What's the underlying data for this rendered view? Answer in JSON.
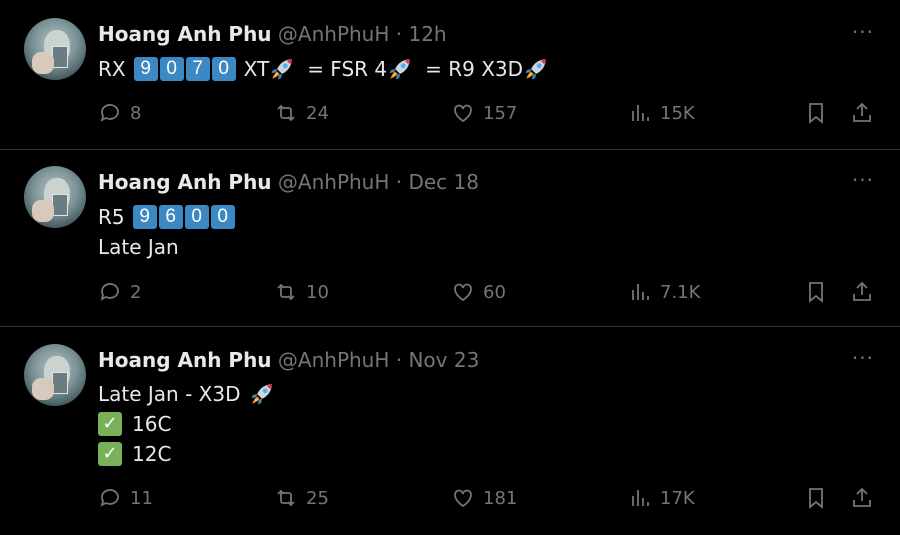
{
  "tweets": [
    {
      "name": "Hoang Anh Phu",
      "handle": "@AnhPhuH",
      "dot": "·",
      "time": "12h",
      "more": "···",
      "line1": {
        "pre": "RX",
        "digits": [
          "9",
          "0",
          "7",
          "0"
        ],
        "post": "XT",
        "mid": "= FSR 4",
        "end": "= R9 X3D"
      },
      "stats": {
        "replies": "8",
        "retweets": "24",
        "likes": "157",
        "views": "15K"
      }
    },
    {
      "name": "Hoang Anh Phu",
      "handle": "@AnhPhuH",
      "dot": "·",
      "time": "Dec 18",
      "more": "···",
      "line1": {
        "pre": "R5",
        "digits": [
          "9",
          "6",
          "0",
          "0"
        ]
      },
      "line2": "Late Jan",
      "stats": {
        "replies": "2",
        "retweets": "10",
        "likes": "60",
        "views": "7.1K"
      }
    },
    {
      "name": "Hoang Anh Phu",
      "handle": "@AnhPhuH",
      "dot": "·",
      "time": "Nov 23",
      "more": "···",
      "line1": "Late Jan - X3D",
      "line2": "16C",
      "line3": "12C",
      "check": "✓",
      "stats": {
        "replies": "11",
        "retweets": "25",
        "likes": "181",
        "views": "17K"
      }
    }
  ],
  "icons": {
    "reply": "reply-icon",
    "retweet": "retweet-icon",
    "like": "heart-icon",
    "views": "views-chart-icon",
    "bookmark": "bookmark-icon",
    "share": "share-icon",
    "rocket": "rocket-emoji",
    "check": "check-mark-emoji"
  },
  "colors": {
    "background": "#000000",
    "text": "#e7e9ea",
    "muted": "#71767b",
    "divider": "#2f3336",
    "keycap": "#3b88c3",
    "check": "#78b159"
  }
}
